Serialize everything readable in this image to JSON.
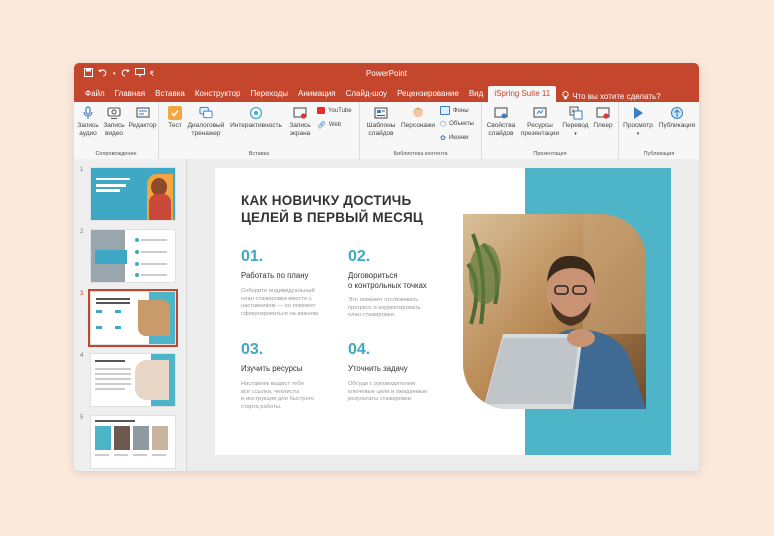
{
  "app": {
    "title": "PowerPoint"
  },
  "qat": {
    "save_icon": "save-icon",
    "undo_icon": "undo-icon",
    "redo_icon": "redo-icon",
    "present_icon": "present-icon"
  },
  "tabs": [
    "Файл",
    "Главная",
    "Вставка",
    "Конструктор",
    "Переходы",
    "Анимация",
    "Слайд-шоу",
    "Рецензирование",
    "Вид",
    "iSpring Suite 11"
  ],
  "tell_me": "Что вы хотите сделать?",
  "ribbon": {
    "groups": {
      "accompaniment": "Сопровождение",
      "insert": "Вставка",
      "library": "Библиотека контента",
      "presentation": "Презентация",
      "publish": "Публикация"
    },
    "buttons": {
      "record_audio": [
        "Запись",
        "аудио"
      ],
      "record_video": [
        "Запись",
        "видео"
      ],
      "editor": "Редактор",
      "test": "Тест",
      "dialog_trainer": [
        "Диалоговый",
        "тренажер"
      ],
      "interactivity": "Интерактивность",
      "screen_record": [
        "Запись",
        "экрана"
      ],
      "youtube": "YouTube",
      "web": "Web",
      "slide_templates": [
        "Шаблоны",
        "слайдов"
      ],
      "characters": "Персонажи",
      "backgrounds": "Фоны",
      "objects": "Объекты",
      "icons": "Иконки",
      "slide_properties": [
        "Свойства",
        "слайдов"
      ],
      "presentation_resources": [
        "Ресурсы",
        "презентации"
      ],
      "translation": "Перевод",
      "player": "Плеер",
      "preview": "Просмотр",
      "publish": "Публикация"
    }
  },
  "thumbnails": {
    "numbers": [
      "1",
      "2",
      "3",
      "4",
      "5"
    ],
    "selected": 3
  },
  "slide": {
    "title_line1": "КАК НОВИЧКУ ДОСТИЧЬ",
    "title_line2": "ЦЕЛЕЙ В ПЕРВЫЙ МЕСЯЦ",
    "items": [
      {
        "num": "01.",
        "title": [
          "Работать по плану"
        ],
        "desc": [
          "Соберите индивидуальный",
          "план стажировки вместе с",
          "наставником — он поможет",
          "сфокусироваться на важном."
        ]
      },
      {
        "num": "02.",
        "title": [
          "Договориться",
          "о контрольных точках"
        ],
        "desc": [
          "Это поможет отслеживать",
          "прогресс и корректировать",
          "план стажировки."
        ]
      },
      {
        "num": "03.",
        "title": [
          "Изучить ресурсы"
        ],
        "desc": [
          "Наставник выдаст тебе",
          "все ссылки, чеклисты",
          "и инструкции для быстрого",
          "старта работы."
        ]
      },
      {
        "num": "04.",
        "title": [
          "Уточнить задачу"
        ],
        "desc": [
          "Обсуди с руководителем",
          "ключевые цели и ожидаемые",
          "результаты стажировки."
        ]
      }
    ]
  },
  "colors": {
    "accent": "#c4472d",
    "teal": "#4eb5c9",
    "number": "#3fa8c4"
  }
}
